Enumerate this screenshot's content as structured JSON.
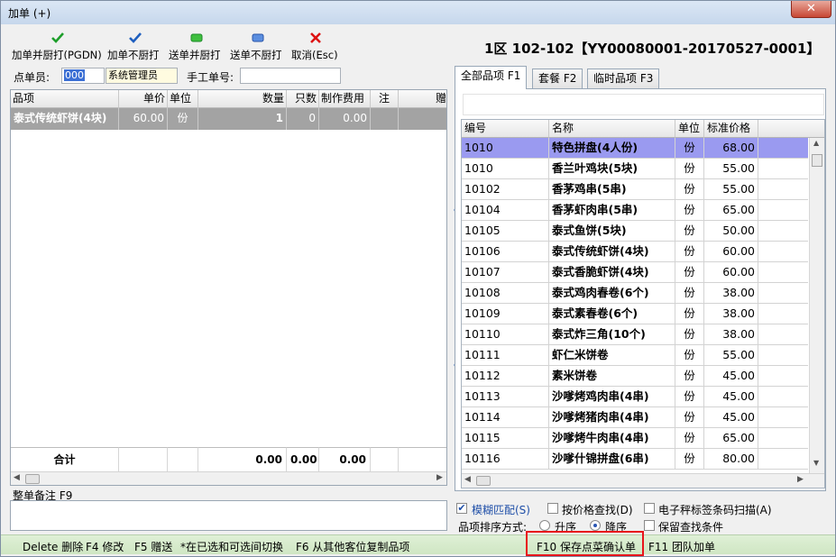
{
  "window": {
    "title": "加单 (+)",
    "close_glyph": "✕"
  },
  "toolbar": {
    "add_print_label": "加单并厨打(PGDN)",
    "add_noprint_label": "加单不厨打",
    "send_print_label": "送单并厨打",
    "send_noprint_label": "送单不厨打",
    "cancel_label": "取消(Esc)"
  },
  "order_info": "1区 102-102【YY00080001-20170527-0001】",
  "form": {
    "waiter_label": "点单员:",
    "waiter_code": "000",
    "waiter_name": "系统管理员",
    "manual_no_label": "手工单号:",
    "manual_no_value": ""
  },
  "order_grid": {
    "columns": [
      "品项",
      "单价",
      "单位",
      "数量",
      "只数",
      "制作费用",
      "注",
      "赠"
    ],
    "rows": [
      {
        "name": "泰式传统虾饼(4块)",
        "price": "60.00",
        "unit": "份",
        "qty": "1",
        "count": "0",
        "fee": "0.00"
      }
    ],
    "total": {
      "label": "合计",
      "qty": "0.00",
      "count": "0.00",
      "fee": "0.00"
    }
  },
  "note": {
    "label": "整单备注 F9",
    "value": ""
  },
  "tabs": [
    {
      "label": "全部品项 F1"
    },
    {
      "label": "套餐 F2"
    },
    {
      "label": "临时品项 F3"
    }
  ],
  "menu_grid": {
    "columns": [
      "编号",
      "名称",
      "单位",
      "标准价格"
    ],
    "rows": [
      {
        "code": "1010",
        "name": "特色拼盘(4人份)",
        "unit": "份",
        "price": "68.00"
      },
      {
        "code": "1010",
        "name": "香兰叶鸡块(5块)",
        "unit": "份",
        "price": "55.00"
      },
      {
        "code": "10102",
        "name": "香茅鸡串(5串)",
        "unit": "份",
        "price": "55.00"
      },
      {
        "code": "10104",
        "name": "香茅虾肉串(5串)",
        "unit": "份",
        "price": "65.00"
      },
      {
        "code": "10105",
        "name": "泰式鱼饼(5块)",
        "unit": "份",
        "price": "50.00"
      },
      {
        "code": "10106",
        "name": "泰式传统虾饼(4块)",
        "unit": "份",
        "price": "60.00"
      },
      {
        "code": "10107",
        "name": "泰式香脆虾饼(4块)",
        "unit": "份",
        "price": "60.00"
      },
      {
        "code": "10108",
        "name": "泰式鸡肉春卷(6个)",
        "unit": "份",
        "price": "38.00"
      },
      {
        "code": "10109",
        "name": "泰式素春卷(6个)",
        "unit": "份",
        "price": "38.00"
      },
      {
        "code": "10110",
        "name": "泰式炸三角(10个)",
        "unit": "份",
        "price": "38.00"
      },
      {
        "code": "10111",
        "name": "虾仁米饼卷",
        "unit": "份",
        "price": "55.00"
      },
      {
        "code": "10112",
        "name": "素米饼卷",
        "unit": "份",
        "price": "45.00"
      },
      {
        "code": "10113",
        "name": "沙嗲烤鸡肉串(4串)",
        "unit": "份",
        "price": "45.00"
      },
      {
        "code": "10114",
        "name": "沙嗲烤猪肉串(4串)",
        "unit": "份",
        "price": "45.00"
      },
      {
        "code": "10115",
        "name": "沙嗲烤牛肉串(4串)",
        "unit": "份",
        "price": "65.00"
      },
      {
        "code": "10116",
        "name": "沙嗲什锦拼盘(6串)",
        "unit": "份",
        "price": "80.00"
      }
    ]
  },
  "options": {
    "fuzzy_label": "模糊匹配(S)",
    "fuzzy_checked": true,
    "price_search_label": "按价格查找(D)",
    "barcode_label": "电子秤标签条码扫描(A)",
    "sort_label": "品项排序方式:",
    "asc_label": "升序",
    "desc_label": "降序",
    "keep_label": "保留查找条件"
  },
  "status": {
    "s1": "Delete 删除",
    "s2": "F4 修改",
    "s3": "F5 赠送",
    "s4": "*在已选和可选间切换",
    "s5": "F6 从其他客位复制品项",
    "s6": "F10 保存点菜确认单",
    "s7": "F11 团队加单"
  },
  "colors": {
    "highlight": "#e8141b",
    "selected_row": "#9a9af0",
    "check_green": "#1d9e2a",
    "check_blue": "#1f5fbf"
  }
}
